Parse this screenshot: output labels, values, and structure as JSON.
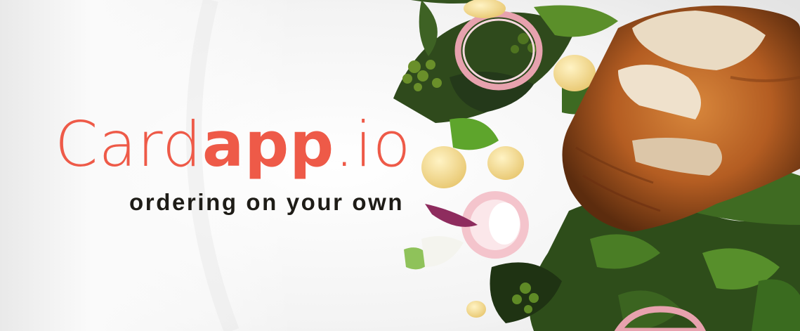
{
  "banner": {
    "logo_part1": "Card",
    "logo_part2": "app",
    "logo_part3": ".io",
    "tagline": "ordering on your own"
  },
  "colors": {
    "brand": "#ee5a48",
    "tagline": "#1e1c17"
  }
}
